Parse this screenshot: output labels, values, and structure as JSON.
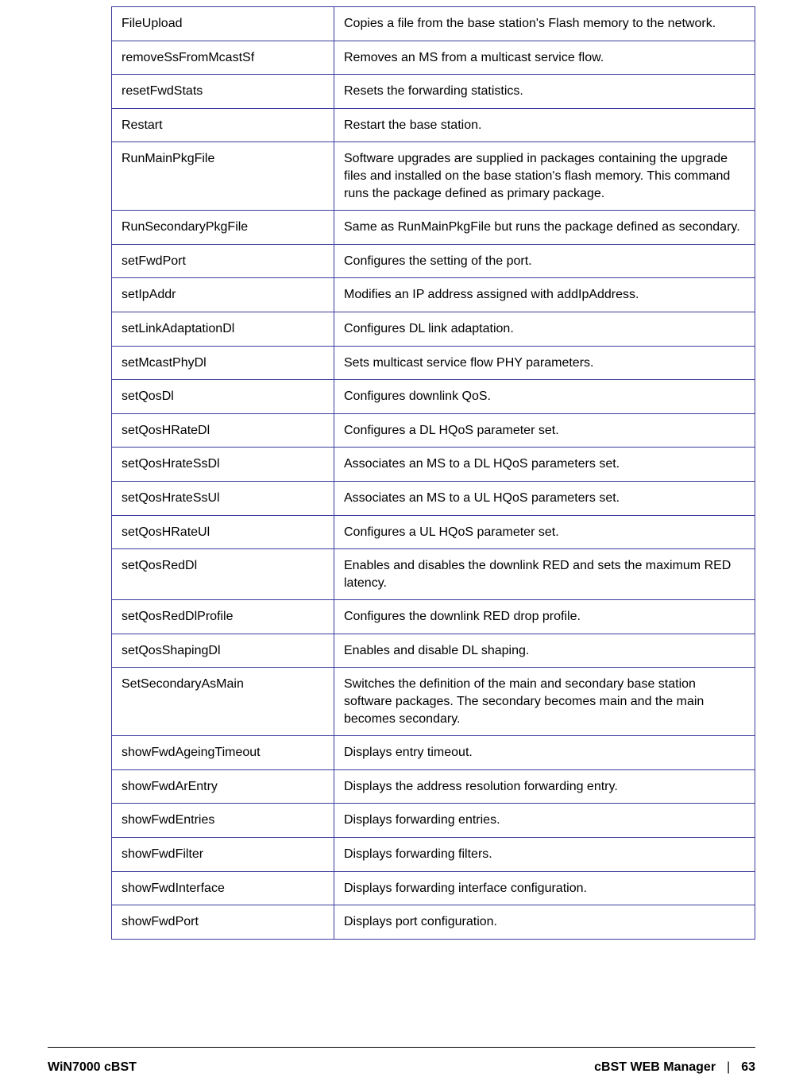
{
  "rows": [
    {
      "command": "FileUpload",
      "description": "Copies a file from the base station's Flash memory to the network."
    },
    {
      "command": "removeSsFromMcastSf",
      "description": "Removes an MS from a multicast service flow."
    },
    {
      "command": "resetFwdStats",
      "description": "Resets the forwarding statistics."
    },
    {
      "command": "Restart",
      "description": "Restart the base station."
    },
    {
      "command": "RunMainPkgFile",
      "description": "Software upgrades are supplied in packages containing the upgrade files and installed on the base station's flash memory. This command runs the package defined as primary package."
    },
    {
      "command": "RunSecondaryPkgFile",
      "description": "Same as RunMainPkgFile but runs the package defined as secondary."
    },
    {
      "command": "setFwdPort",
      "description": "Configures the setting of the port."
    },
    {
      "command": "setIpAddr",
      "description": "Modifies an IP address assigned with addIpAddress."
    },
    {
      "command": "setLinkAdaptationDl",
      "description": "Configures DL link adaptation."
    },
    {
      "command": "setMcastPhyDl",
      "description": "Sets multicast service flow PHY parameters."
    },
    {
      "command": "setQosDl",
      "description": "Configures downlink QoS."
    },
    {
      "command": "setQosHRateDl",
      "description": "Configures a DL HQoS parameter set."
    },
    {
      "command": "setQosHrateSsDl",
      "description": "Associates an MS to a DL HQoS parameters set."
    },
    {
      "command": "setQosHrateSsUl",
      "description": "Associates an MS to a UL HQoS parameters set."
    },
    {
      "command": "setQosHRateUl",
      "description": "Configures a UL HQoS parameter set."
    },
    {
      "command": "setQosRedDl",
      "description": "Enables and disables the downlink RED and sets the maximum RED latency."
    },
    {
      "command": "setQosRedDlProfile",
      "description": "Configures the downlink RED drop profile."
    },
    {
      "command": "setQosShapingDl",
      "description": "Enables and disable DL shaping."
    },
    {
      "command": "SetSecondaryAsMain",
      "description": "Switches the definition of the main and secondary base station software packages. The secondary becomes main and the main becomes secondary."
    },
    {
      "command": "showFwdAgeingTimeout",
      "description": "Displays entry timeout."
    },
    {
      "command": "showFwdArEntry",
      "description": "Displays the address resolution forwarding entry."
    },
    {
      "command": "showFwdEntries",
      "description": "Displays forwarding entries."
    },
    {
      "command": "showFwdFilter",
      "description": "Displays forwarding filters."
    },
    {
      "command": "showFwdInterface",
      "description": "Displays forwarding interface configuration."
    },
    {
      "command": "showFwdPort",
      "description": "Displays port configuration."
    }
  ],
  "footer": {
    "left": "WiN7000 cBST",
    "section": "cBST WEB Manager",
    "separator": "|",
    "page": "63"
  }
}
